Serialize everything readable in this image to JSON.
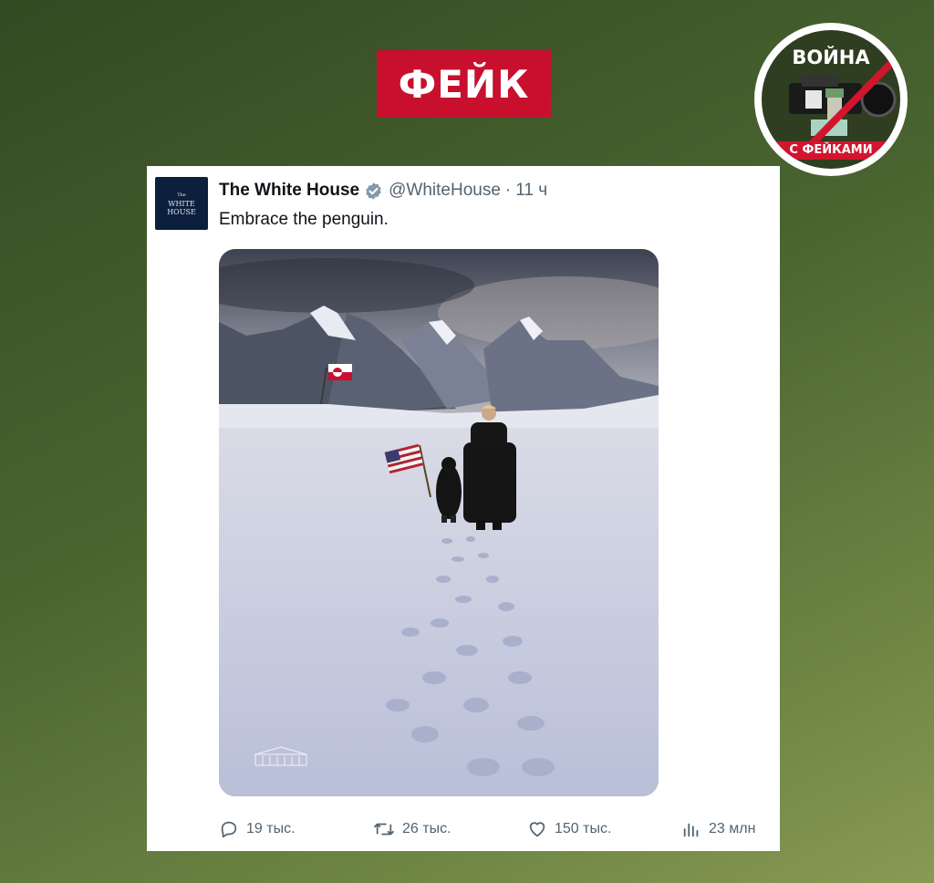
{
  "banner": {
    "label": "ФЕЙК"
  },
  "logo": {
    "top_text": "ВОЙНА",
    "bottom_text": "С ФЕЙКАМИ"
  },
  "tweet": {
    "avatar_lines": [
      "The",
      "WHITE",
      "HOUSE"
    ],
    "author_name": "The White House",
    "handle": "@WhiteHouse",
    "separator": "·",
    "time": "11 ч",
    "text": "Embrace the penguin.",
    "media": {
      "image": "ai-image-penguin-and-man-walking-on-snow",
      "icons": [
        "greenland-flag-icon",
        "us-flag-icon",
        "white-house-watermark-icon"
      ]
    },
    "actions": {
      "replies": "19 тыс.",
      "retweets": "26 тыс.",
      "likes": "150 тыс.",
      "views": "23 млн"
    }
  },
  "colors": {
    "banner_red": "#c8102e",
    "verified_blue": "#829aab",
    "text_gray": "#536471"
  }
}
